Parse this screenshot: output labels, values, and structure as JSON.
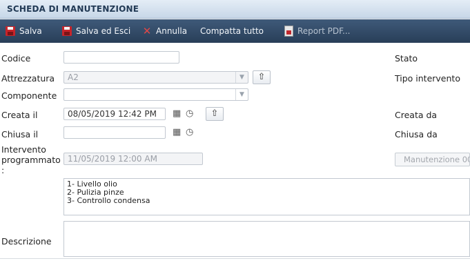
{
  "window": {
    "title": "SCHEDA DI MANUTENZIONE"
  },
  "toolbar": {
    "save_label": "Salva",
    "save_exit_label": "Salva ed Esci",
    "cancel_label": "Annulla",
    "compact_label": "Compatta tutto",
    "report_label": "Report PDF..."
  },
  "form": {
    "codice": {
      "label": "Codice",
      "value": ""
    },
    "attrezzatura": {
      "label": "Attrezzatura",
      "value": "A2"
    },
    "componente": {
      "label": "Componente",
      "value": ""
    },
    "creata_il": {
      "label": "Creata il",
      "value": "08/05/2019 12:42 PM"
    },
    "chiusa_il": {
      "label": "Chiusa il",
      "value": ""
    },
    "intervento": {
      "label_line1": "Intervento",
      "label_line2": "programmato",
      "label_line3": ":",
      "value": "11/05/2019 12:00 AM"
    },
    "manutenzione_button": "Manutenzione 00",
    "stato": {
      "label": "Stato"
    },
    "tipo_intervento": {
      "label": "Tipo intervento"
    },
    "creata_da": {
      "label": "Creata da"
    },
    "chiusa_da": {
      "label": "Chiusa da"
    },
    "note_lines": [
      "1- Livello olio",
      "2- Pulizia pinze",
      "3- Controllo condensa"
    ],
    "descrizione": {
      "label": "Descrizione",
      "value": ""
    }
  },
  "icons": {
    "save": "floppy-disk-icon",
    "cancel": "x-icon",
    "report": "pdf-icon",
    "calendar": "calendar-icon",
    "clock": "clock-icon",
    "up": "arrow-up-icon",
    "dropdown": "chevron-down-icon"
  },
  "colors": {
    "toolbar_bg": "#33506f",
    "titlebar_bg": "#d3e1ef",
    "cancel_icon": "#e04848",
    "save_icon": "#c8242a"
  }
}
